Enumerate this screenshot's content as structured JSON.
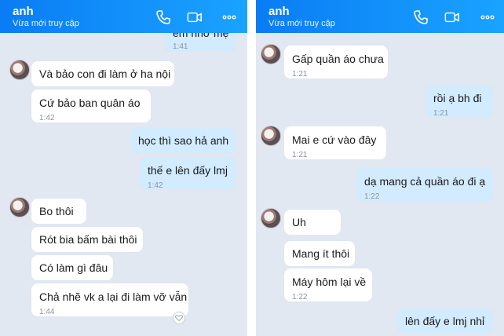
{
  "left": {
    "contact_name": "anh",
    "contact_status": "Vừa mới truy cập",
    "partial_top_text": "em nhớ mẹ",
    "partial_top_time": "1:41",
    "messages": [
      {
        "text": "Và bảo con đi làm ở ha nội",
        "time": ""
      },
      {
        "text": "Cứ bảo ban quân áo",
        "time": "1:42"
      },
      {
        "text": "học thì sao hả anh",
        "time": ""
      },
      {
        "text": "thế e lên đấy lmj",
        "time": "1:42"
      },
      {
        "text": "Bo thôi",
        "time": ""
      },
      {
        "text": "Rót bia bấm bài thôi",
        "time": ""
      },
      {
        "text": "Có làm gì đâu",
        "time": ""
      },
      {
        "text": "Chả nhẽ vk a lại đi làm vỡ vẫn",
        "time": "1:44"
      }
    ]
  },
  "right": {
    "contact_name": "anh",
    "contact_status": "Vừa mới truy cập",
    "messages": [
      {
        "text": "Gấp quần áo chưa",
        "time": "1:21"
      },
      {
        "text": "rồi ạ bh đi",
        "time": "1:21"
      },
      {
        "text": "Mai e cứ vào đây",
        "time": "1:21"
      },
      {
        "text": "dạ mang cả quần áo đi ạ",
        "time": "1:22"
      },
      {
        "text": "Uh",
        "time": ""
      },
      {
        "text": "Mang ít thôi",
        "time": ""
      },
      {
        "text": "Máy hôm lại về",
        "time": "1:22"
      },
      {
        "text": "lên đấy e lmj nhỉ",
        "time": ""
      }
    ]
  },
  "colors": {
    "header_start": "#0a7cf5",
    "header_end": "#1aa3ff",
    "chat_background": "#e2e8f1",
    "incoming_bubble": "#ffffff",
    "outgoing_bubble": "#d3ebff"
  },
  "icons": [
    "phone-icon",
    "video-call-icon",
    "more-options-icon",
    "avatar",
    "heart-reaction-icon"
  ]
}
